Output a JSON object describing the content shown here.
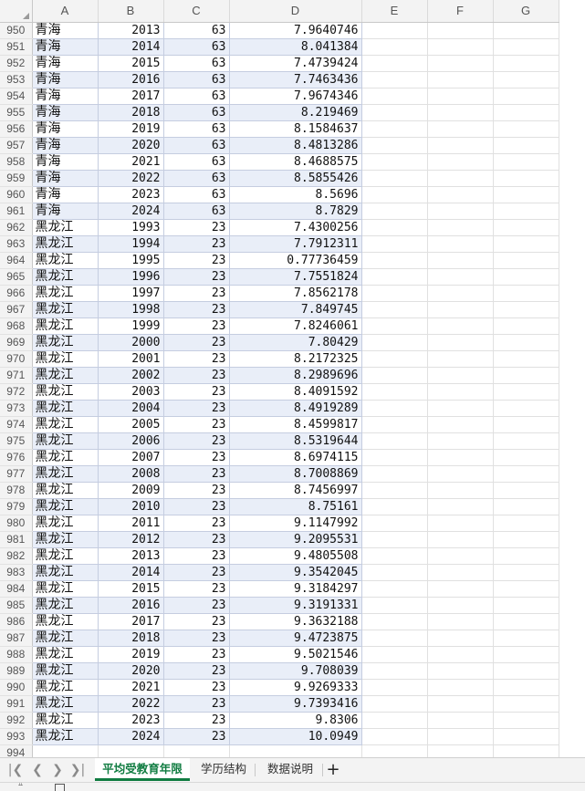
{
  "columns": [
    "A",
    "B",
    "C",
    "D",
    "E",
    "F",
    "G"
  ],
  "rows": [
    {
      "n": "950",
      "a": "青海",
      "b": "2013",
      "c": "63",
      "d": "7.9640746"
    },
    {
      "n": "951",
      "a": "青海",
      "b": "2014",
      "c": "63",
      "d": "8.041384"
    },
    {
      "n": "952",
      "a": "青海",
      "b": "2015",
      "c": "63",
      "d": "7.4739424"
    },
    {
      "n": "953",
      "a": "青海",
      "b": "2016",
      "c": "63",
      "d": "7.7463436"
    },
    {
      "n": "954",
      "a": "青海",
      "b": "2017",
      "c": "63",
      "d": "7.9674346"
    },
    {
      "n": "955",
      "a": "青海",
      "b": "2018",
      "c": "63",
      "d": "8.219469"
    },
    {
      "n": "956",
      "a": "青海",
      "b": "2019",
      "c": "63",
      "d": "8.1584637"
    },
    {
      "n": "957",
      "a": "青海",
      "b": "2020",
      "c": "63",
      "d": "8.4813286"
    },
    {
      "n": "958",
      "a": "青海",
      "b": "2021",
      "c": "63",
      "d": "8.4688575"
    },
    {
      "n": "959",
      "a": "青海",
      "b": "2022",
      "c": "63",
      "d": "8.5855426"
    },
    {
      "n": "960",
      "a": "青海",
      "b": "2023",
      "c": "63",
      "d": "8.5696"
    },
    {
      "n": "961",
      "a": "青海",
      "b": "2024",
      "c": "63",
      "d": "8.7829"
    },
    {
      "n": "962",
      "a": "黑龙江",
      "b": "1993",
      "c": "23",
      "d": "7.4300256"
    },
    {
      "n": "963",
      "a": "黑龙江",
      "b": "1994",
      "c": "23",
      "d": "7.7912311"
    },
    {
      "n": "964",
      "a": "黑龙江",
      "b": "1995",
      "c": "23",
      "d": "0.77736459"
    },
    {
      "n": "965",
      "a": "黑龙江",
      "b": "1996",
      "c": "23",
      "d": "7.7551824"
    },
    {
      "n": "966",
      "a": "黑龙江",
      "b": "1997",
      "c": "23",
      "d": "7.8562178"
    },
    {
      "n": "967",
      "a": "黑龙江",
      "b": "1998",
      "c": "23",
      "d": "7.849745"
    },
    {
      "n": "968",
      "a": "黑龙江",
      "b": "1999",
      "c": "23",
      "d": "7.8246061"
    },
    {
      "n": "969",
      "a": "黑龙江",
      "b": "2000",
      "c": "23",
      "d": "7.80429"
    },
    {
      "n": "970",
      "a": "黑龙江",
      "b": "2001",
      "c": "23",
      "d": "8.2172325"
    },
    {
      "n": "971",
      "a": "黑龙江",
      "b": "2002",
      "c": "23",
      "d": "8.2989696"
    },
    {
      "n": "972",
      "a": "黑龙江",
      "b": "2003",
      "c": "23",
      "d": "8.4091592"
    },
    {
      "n": "973",
      "a": "黑龙江",
      "b": "2004",
      "c": "23",
      "d": "8.4919289"
    },
    {
      "n": "974",
      "a": "黑龙江",
      "b": "2005",
      "c": "23",
      "d": "8.4599817"
    },
    {
      "n": "975",
      "a": "黑龙江",
      "b": "2006",
      "c": "23",
      "d": "8.5319644"
    },
    {
      "n": "976",
      "a": "黑龙江",
      "b": "2007",
      "c": "23",
      "d": "8.6974115"
    },
    {
      "n": "977",
      "a": "黑龙江",
      "b": "2008",
      "c": "23",
      "d": "8.7008869"
    },
    {
      "n": "978",
      "a": "黑龙江",
      "b": "2009",
      "c": "23",
      "d": "8.7456997"
    },
    {
      "n": "979",
      "a": "黑龙江",
      "b": "2010",
      "c": "23",
      "d": "8.75161"
    },
    {
      "n": "980",
      "a": "黑龙江",
      "b": "2011",
      "c": "23",
      "d": "9.1147992"
    },
    {
      "n": "981",
      "a": "黑龙江",
      "b": "2012",
      "c": "23",
      "d": "9.2095531"
    },
    {
      "n": "982",
      "a": "黑龙江",
      "b": "2013",
      "c": "23",
      "d": "9.4805508"
    },
    {
      "n": "983",
      "a": "黑龙江",
      "b": "2014",
      "c": "23",
      "d": "9.3542045"
    },
    {
      "n": "984",
      "a": "黑龙江",
      "b": "2015",
      "c": "23",
      "d": "9.3184297"
    },
    {
      "n": "985",
      "a": "黑龙江",
      "b": "2016",
      "c": "23",
      "d": "9.3191331"
    },
    {
      "n": "986",
      "a": "黑龙江",
      "b": "2017",
      "c": "23",
      "d": "9.3632188"
    },
    {
      "n": "987",
      "a": "黑龙江",
      "b": "2018",
      "c": "23",
      "d": "9.4723875"
    },
    {
      "n": "988",
      "a": "黑龙江",
      "b": "2019",
      "c": "23",
      "d": "9.5021546"
    },
    {
      "n": "989",
      "a": "黑龙江",
      "b": "2020",
      "c": "23",
      "d": "9.708039"
    },
    {
      "n": "990",
      "a": "黑龙江",
      "b": "2021",
      "c": "23",
      "d": "9.9269333"
    },
    {
      "n": "991",
      "a": "黑龙江",
      "b": "2022",
      "c": "23",
      "d": "9.7393416"
    },
    {
      "n": "992",
      "a": "黑龙江",
      "b": "2023",
      "c": "23",
      "d": "9.8306"
    },
    {
      "n": "993",
      "a": "黑龙江",
      "b": "2024",
      "c": "23",
      "d": "10.0949"
    },
    {
      "n": "994",
      "a": "",
      "b": "",
      "c": "",
      "d": ""
    }
  ],
  "sheet_tabs": [
    "平均受教育年限",
    "学历结构",
    "数据说明"
  ],
  "active_tab": "平均受教育年限",
  "nav_icons": [
    "first-sheet-icon",
    "prev-sheet-icon",
    "next-sheet-icon",
    "last-sheet-icon"
  ],
  "add_sheet_label": "+",
  "colors": {
    "accent": "#107c41",
    "band": "#e9eef8",
    "header_bg": "#f3f3f3"
  }
}
